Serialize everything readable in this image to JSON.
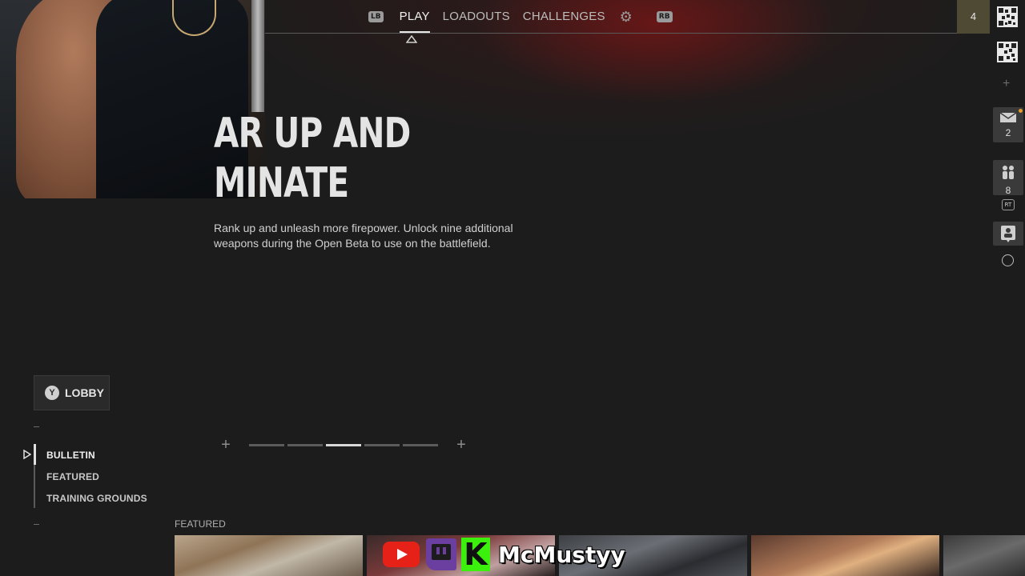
{
  "nav": {
    "left_bumper": "LB",
    "right_bumper": "RB",
    "tabs": [
      {
        "label": "PLAY",
        "active": true
      },
      {
        "label": "LOADOUTS",
        "active": false
      },
      {
        "label": "CHALLENGES",
        "active": false
      }
    ]
  },
  "rail": {
    "level": "4",
    "mail_count": "2",
    "squad_count": "8",
    "rt_label": "RT"
  },
  "hero": {
    "title_line1": "AR UP AND",
    "title_line2": "MINATE",
    "description": "Rank up and unleash more firepower. Unlock nine additional weapons during the Open Beta to use on the battlefield."
  },
  "carousel": {
    "slide_count": 5,
    "active_index": 2
  },
  "lobby": {
    "button_glyph": "Y",
    "label": "LOBBY"
  },
  "menu": {
    "items": [
      {
        "label": "BULLETIN",
        "active": true
      },
      {
        "label": "FEATURED",
        "active": false
      },
      {
        "label": "TRAINING GROUNDS",
        "active": false
      }
    ]
  },
  "featured": {
    "label": "FEATURED"
  },
  "stream_overlay": {
    "handle": "McMustyy"
  },
  "colors": {
    "background": "#1c1c1c",
    "level_box": "#4f4a33",
    "notification_dot": "#e59a2a"
  }
}
